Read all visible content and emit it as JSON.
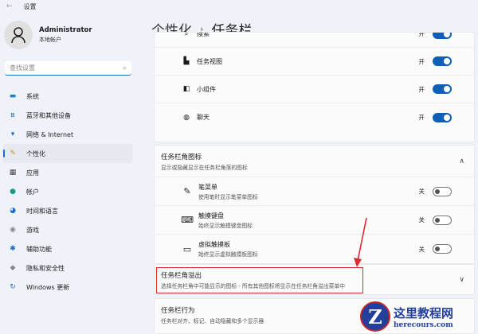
{
  "window": {
    "back": "←",
    "title": "设置"
  },
  "profile": {
    "name": "Administrator",
    "type": "本地帐户"
  },
  "search": {
    "placeholder": "查找设置",
    "icon": "⌕"
  },
  "nav": [
    {
      "label": "系统",
      "icon": "▬",
      "color": "#1b7fc9"
    },
    {
      "label": "蓝牙和其他设备",
      "icon": "ʙ",
      "color": "#1b6cc1"
    },
    {
      "label": "网络 & Internet",
      "icon": "▾",
      "color": "#1b6cc1"
    },
    {
      "label": "个性化",
      "icon": "✎",
      "color": "#d08a2a"
    },
    {
      "label": "应用",
      "icon": "▦",
      "color": "#445"
    },
    {
      "label": "帐户",
      "icon": "●",
      "color": "#1a9b8a"
    },
    {
      "label": "时间和语言",
      "icon": "◕",
      "color": "#1b6cc1"
    },
    {
      "label": "游戏",
      "icon": "◉",
      "color": "#888"
    },
    {
      "label": "辅助功能",
      "icon": "✱",
      "color": "#1b6cc1"
    },
    {
      "label": "隐私和安全性",
      "icon": "◆",
      "color": "#888"
    },
    {
      "label": "Windows 更新",
      "icon": "↻",
      "color": "#1b6cc1"
    }
  ],
  "breadcrumb": {
    "parent": "个性化",
    "sep": "›",
    "current": "任务栏"
  },
  "taskbar_items": [
    {
      "label": "搜索",
      "state": "开",
      "icon": "⌕"
    },
    {
      "label": "任务视图",
      "state": "开",
      "icon": "▙"
    },
    {
      "label": "小组件",
      "state": "开",
      "icon": "◧"
    },
    {
      "label": "聊天",
      "state": "开",
      "icon": "◍"
    }
  ],
  "corner_icons": {
    "title": "任务栏角图标",
    "subtitle": "显示或隐藏显示在任务栏角落的图标",
    "chevron": "∧",
    "items": [
      {
        "label": "笔菜单",
        "desc": "使用笔时显示笔菜单图标",
        "state": "关",
        "icon": "✎"
      },
      {
        "label": "触摸键盘",
        "desc": "始终显示触摸键盘图标",
        "state": "关",
        "icon": "⌨"
      },
      {
        "label": "虚拟触摸板",
        "desc": "始终显示虚拟触摸板图标",
        "state": "关",
        "icon": "▭"
      }
    ]
  },
  "overflow": {
    "title": "任务栏角溢出",
    "subtitle": "选择任务栏角中可能显示的图标 - 所有其他图标将显示在任务栏角溢出菜单中",
    "chevron": "∨"
  },
  "behavior": {
    "title": "任务栏行为",
    "subtitle": "任务栏对齐、标记、自动隐藏和多个显示器"
  },
  "watermark": {
    "logo": "Z",
    "name": "这里教程网",
    "url": "herecours.com"
  }
}
